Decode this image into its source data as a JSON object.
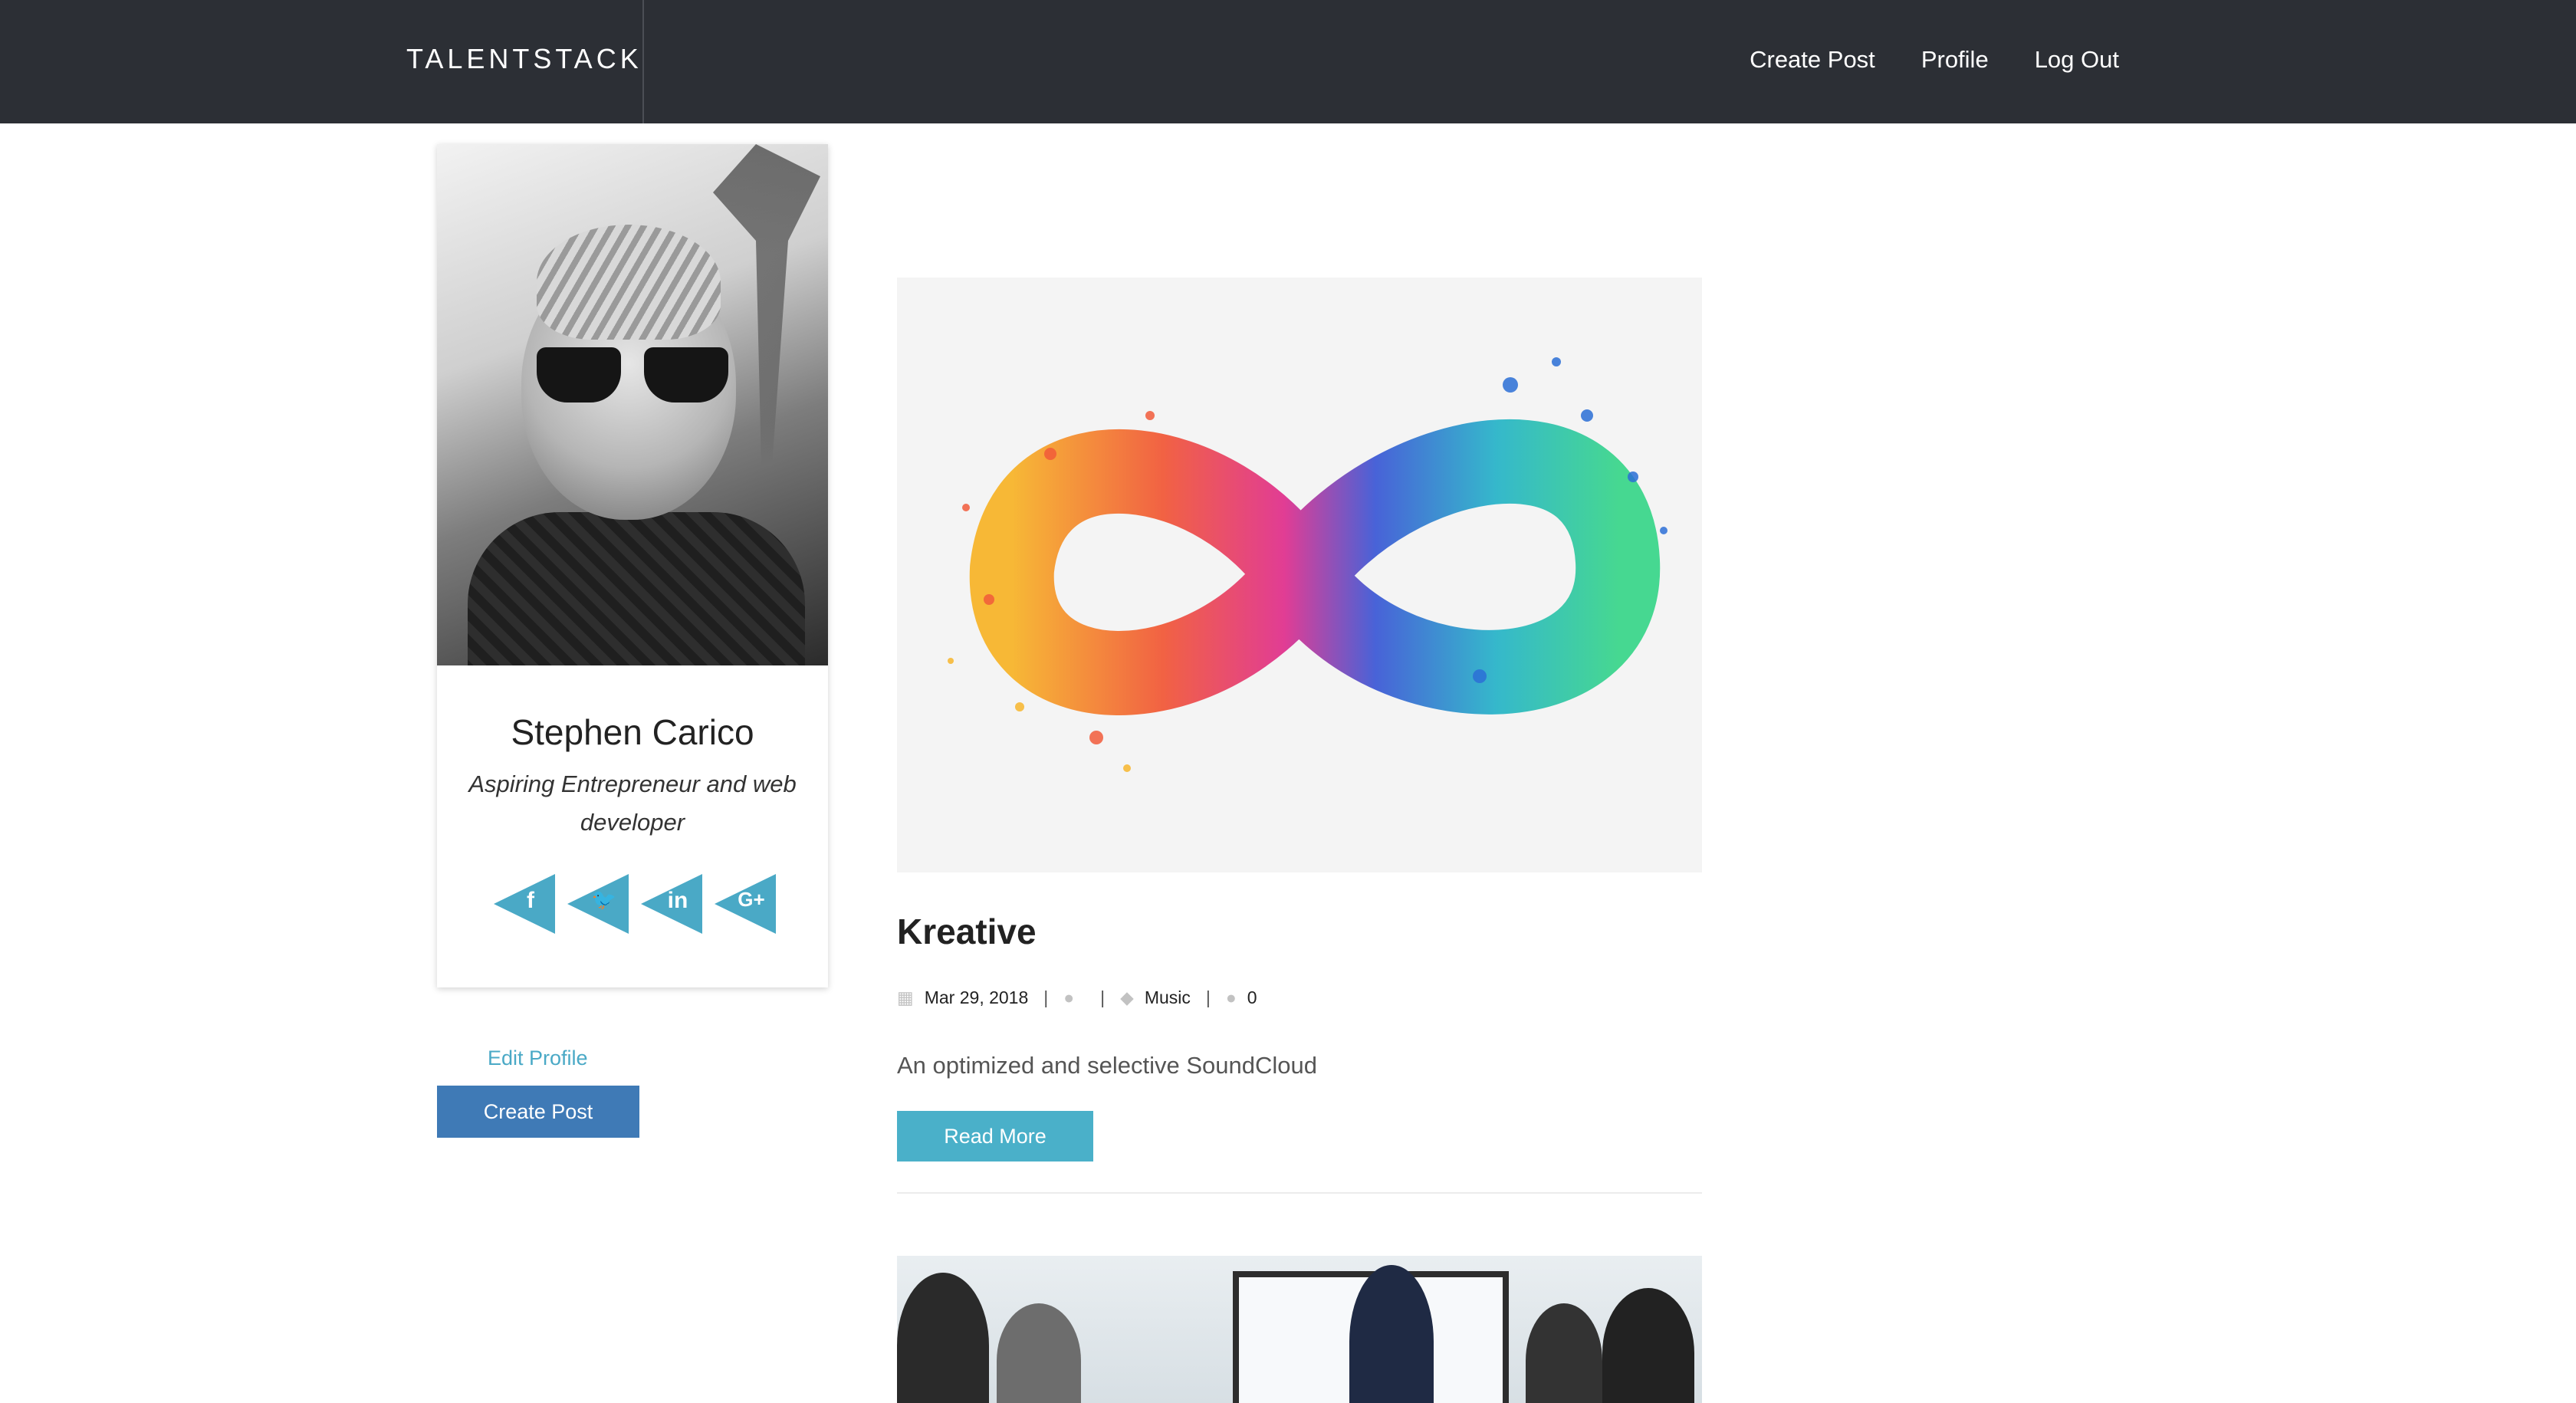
{
  "navbar": {
    "brand": "TALENTSTACK",
    "links": [
      "Create Post",
      "Profile",
      "Log Out"
    ]
  },
  "profile": {
    "name": "Stephen Carico",
    "tagline": "Aspiring Entrepreneur and web developer",
    "socials": [
      {
        "icon": "facebook-icon",
        "glyph": "f"
      },
      {
        "icon": "twitter-icon",
        "glyph": "🐦"
      },
      {
        "icon": "linkedin-icon",
        "glyph": "in"
      },
      {
        "icon": "google-plus-icon",
        "glyph": "G+"
      }
    ],
    "edit_label": "Edit Profile",
    "create_label": "Create Post"
  },
  "posts": [
    {
      "title": "Kreative",
      "date": "Mar 29, 2018",
      "author": "",
      "category": "Music",
      "comments": "0",
      "excerpt": "An optimized and selective SoundCloud",
      "read_more": "Read More"
    }
  ],
  "colors": {
    "navbar": "#2c2f35",
    "accent": "#4aa9c6",
    "primary_button": "#3f7ab6"
  }
}
